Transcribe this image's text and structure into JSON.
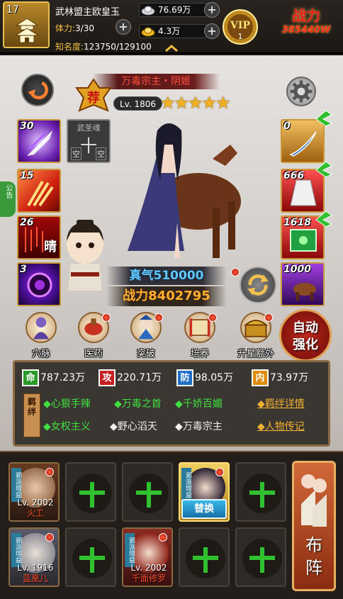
{
  "player": {
    "level": "17",
    "name": "武林盟主欧皇玉",
    "stamina_label": "体力:",
    "stamina_value": "3/30",
    "fame_label": "知名度:",
    "fame_value": "123750/129100",
    "silver": "76.69万",
    "gold": "4.3万",
    "vip_label": "VIP",
    "vip_level": "1",
    "power_title": "战力",
    "power_boost": "385440W"
  },
  "hero": {
    "title": "万毒宗主・阴姬",
    "badge": "荐",
    "level": "Lv. 1806",
    "stars": "★★★★★",
    "qi": "真气510000",
    "power": "战力8402795"
  },
  "side_tab": "公告",
  "left_slots": [
    {
      "num": "30",
      "emblem": ""
    },
    {
      "num": "15",
      "emblem": ""
    },
    {
      "num": "26",
      "emblem": "晴"
    },
    {
      "num": "3",
      "emblem": ""
    }
  ],
  "soul_slot": {
    "top": "武圣魂",
    "mid": "十",
    "bl": "空",
    "br": "空"
  },
  "right_slots": [
    {
      "num": "0"
    },
    {
      "num": "666"
    },
    {
      "num": "1618"
    },
    {
      "num": "1000"
    }
  ],
  "actions": [
    {
      "label": "穴脉"
    },
    {
      "label": "医药"
    },
    {
      "label": "突破"
    },
    {
      "label": "培养"
    },
    {
      "label": "升星额外"
    }
  ],
  "auto_strengthen": "自动强化",
  "stats": [
    {
      "icon": "命",
      "value": "787.23万",
      "color": "#2a9a2a"
    },
    {
      "icon": "攻",
      "value": "220.71万",
      "color": "#c82020"
    },
    {
      "icon": "防",
      "value": "98.05万",
      "color": "#2070c8"
    },
    {
      "icon": "内",
      "value": "73.97万",
      "color": "#e08a10"
    }
  ],
  "bond_label": "羁绊",
  "bonds_row1": [
    "◆心狠手辣",
    "◆万毒之首",
    "◆千娇百媚"
  ],
  "bonds_row2": [
    "◆女权主义",
    "◆野心滔天",
    "◆万毒宗主"
  ],
  "links": {
    "bond_detail": "◆羁绊详情",
    "biography": "◆人物传记"
  },
  "lineup": {
    "heroes": [
      {
        "level": "Lv. 2002",
        "name": "火工",
        "tag": "邪派增益"
      },
      {
        "level": "Lv. 1916",
        "name": "蓝凰儿",
        "tag": "邪派增益"
      },
      {
        "level": "Lv. 2002",
        "name": "千面修罗",
        "tag": "邪派增益"
      }
    ],
    "active": {
      "tag": "邪派增益"
    },
    "empty_mark": "十",
    "swap_label": "替换",
    "formation_label": "布阵"
  },
  "colors": {
    "accent_gold": "#e8c050",
    "bond_active": "#40e040",
    "link": "#f0b030",
    "hero_name": "#ff5030"
  }
}
